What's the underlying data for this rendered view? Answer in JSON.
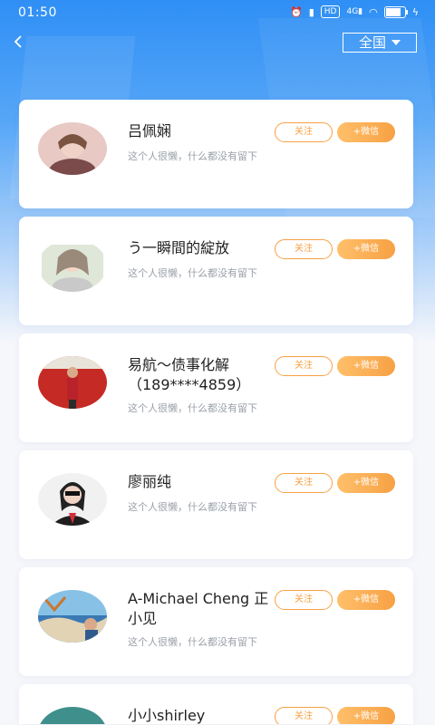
{
  "status": {
    "time": "01:50",
    "icons": [
      "alarm-icon",
      "vibrate-icon",
      "hd-icon",
      "4g-signal-icon",
      "wifi-icon",
      "battery-icon",
      "charging-icon"
    ],
    "battery_level": 0.8
  },
  "header": {
    "region": "全国"
  },
  "users": [
    {
      "name": "吕佩娴",
      "desc": "这个人很懒，什么都没有留下",
      "follow": "关注",
      "wechat": "+微信"
    },
    {
      "name": "う一瞬間的綻放",
      "desc": "这个人很懒，什么都没有留下",
      "follow": "关注",
      "wechat": "+微信"
    },
    {
      "name": "易航～债事化解（189****4859）",
      "desc": "这个人很懒，什么都没有留下",
      "follow": "关注",
      "wechat": "+微信"
    },
    {
      "name": "廖丽纯",
      "desc": "这个人很懒，什么都没有留下",
      "follow": "关注",
      "wechat": "+微信"
    },
    {
      "name": "A-Michael Cheng 正小见",
      "desc": "这个人很懒，什么都没有留下",
      "follow": "关注",
      "wechat": "+微信"
    },
    {
      "name": "小小shirley",
      "desc": "",
      "follow": "关注",
      "wechat": "+微信"
    }
  ],
  "colors": {
    "accent": "#f7a144",
    "header_blue": "#2f8ff5"
  }
}
